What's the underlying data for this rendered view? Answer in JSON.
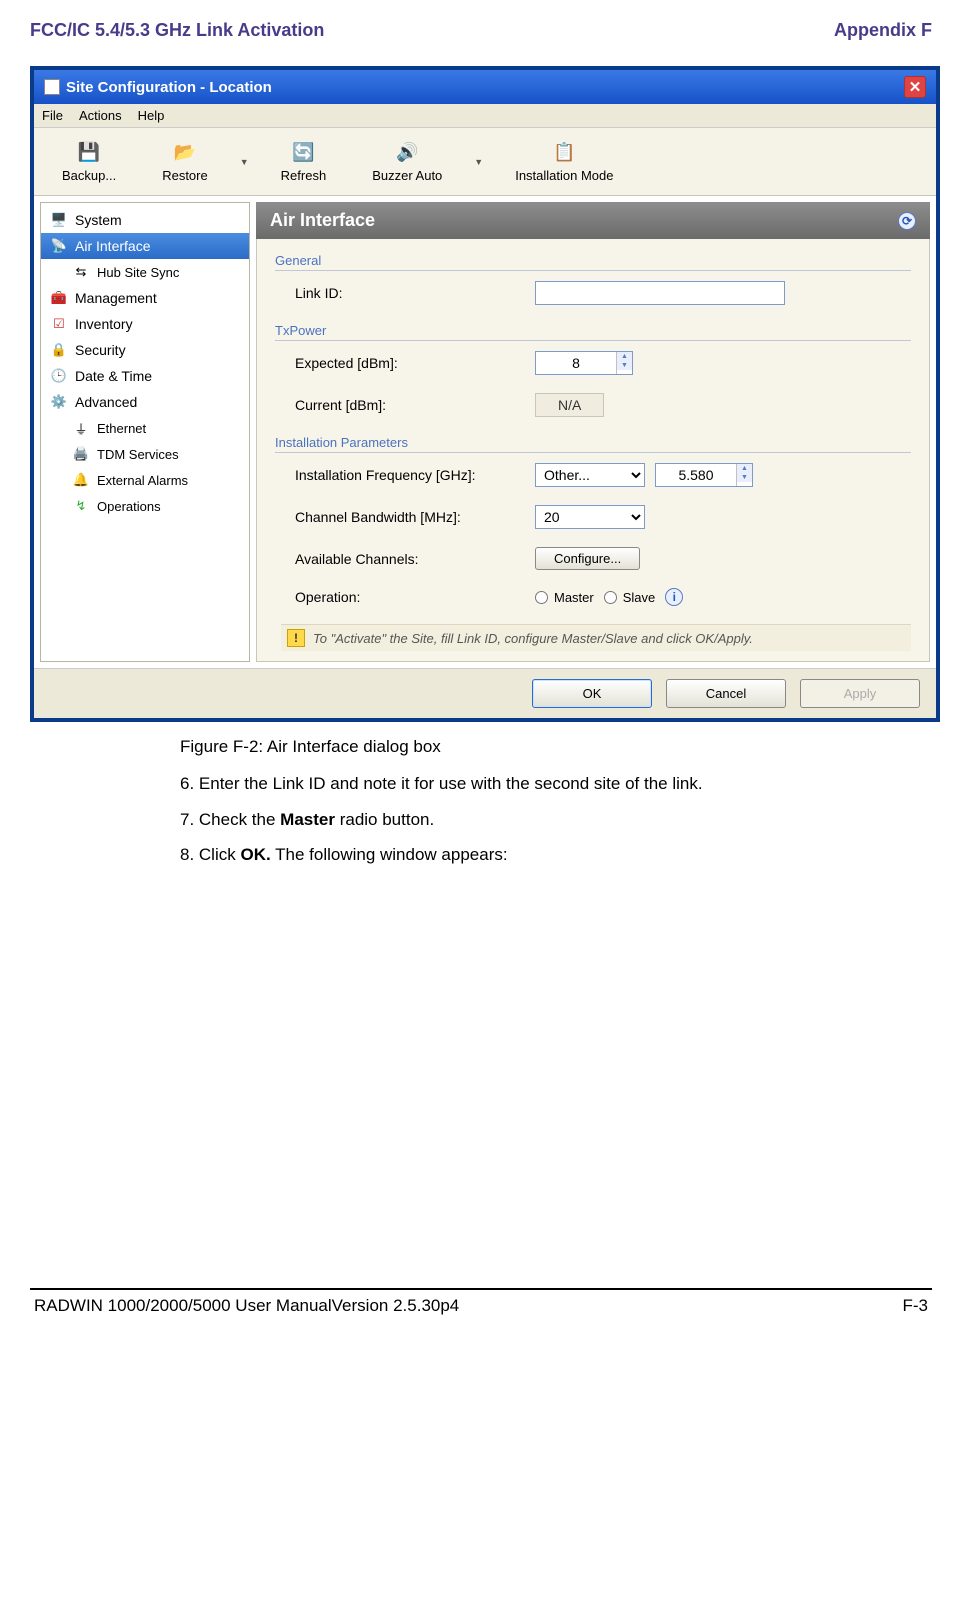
{
  "header": {
    "left": "FCC/IC 5.4/5.3 GHz Link Activation",
    "right": "Appendix F"
  },
  "window": {
    "title": "Site Configuration - Location"
  },
  "menu": {
    "file": "File",
    "actions": "Actions",
    "help": "Help"
  },
  "toolbar": {
    "backup": "Backup...",
    "restore": "Restore",
    "refresh": "Refresh",
    "buzzer": "Buzzer Auto",
    "install": "Installation Mode"
  },
  "sidebar": {
    "system": "System",
    "air": "Air Interface",
    "hub": "Hub Site Sync",
    "mgmt": "Management",
    "inv": "Inventory",
    "sec": "Security",
    "date": "Date & Time",
    "adv": "Advanced",
    "eth": "Ethernet",
    "tdm": "TDM Services",
    "ext": "External Alarms",
    "ops": "Operations"
  },
  "pane": {
    "title": "Air Interface"
  },
  "group": {
    "general": "General",
    "txpower": "TxPower",
    "install": "Installation Parameters"
  },
  "form": {
    "linkid_label": "Link ID:",
    "linkid_value": "",
    "expected_label": "Expected [dBm]:",
    "expected_value": "8",
    "current_label": "Current [dBm]:",
    "current_value": "N/A",
    "freq_label": "Installation Frequency [GHz]:",
    "freq_select": "Other...",
    "freq_value": "5.580",
    "bw_label": "Channel Bandwidth [MHz]:",
    "bw_select": "20",
    "channels_label": "Available Channels:",
    "channels_btn": "Configure...",
    "op_label": "Operation:",
    "op_master": "Master",
    "op_slave": "Slave"
  },
  "note": "To \"Activate\" the Site, fill Link ID, configure Master/Slave and click OK/Apply.",
  "buttons": {
    "ok": "OK",
    "cancel": "Cancel",
    "apply": "Apply"
  },
  "caption": "Figure F-2: Air Interface dialog box",
  "instr": {
    "i6": "6. Enter the Link ID and note it for use with the second site of the link.",
    "i7a": "7. Check the ",
    "i7b": "Master",
    "i7c": " radio button.",
    "i8a": "8. Click ",
    "i8b": "OK.",
    "i8c": " The following window appears:"
  },
  "footer": {
    "left": "RADWIN 1000/2000/5000 User ManualVersion  2.5.30p4",
    "right": "F-3"
  }
}
